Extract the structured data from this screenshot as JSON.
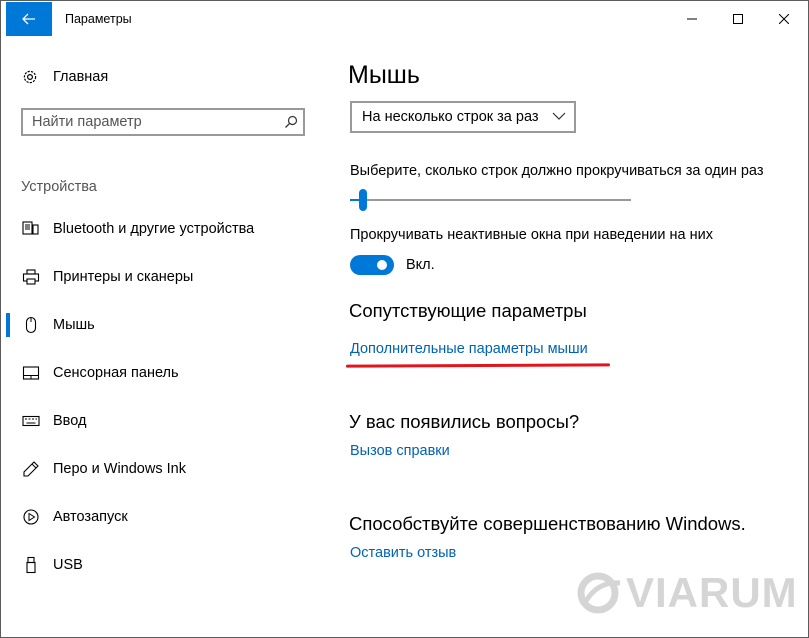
{
  "window": {
    "title": "Параметры",
    "controls": {
      "minimize": "minimize",
      "maximize": "maximize",
      "close": "close"
    }
  },
  "sidebar": {
    "home_label": "Главная",
    "search_placeholder": "Найти параметр",
    "section_title": "Устройства",
    "items": [
      {
        "label": "Bluetooth и другие устройства",
        "icon": "bluetooth-devices-icon",
        "selected": false
      },
      {
        "label": "Принтеры и сканеры",
        "icon": "printer-icon",
        "selected": false
      },
      {
        "label": "Мышь",
        "icon": "mouse-icon",
        "selected": true
      },
      {
        "label": "Сенсорная панель",
        "icon": "touchpad-icon",
        "selected": false
      },
      {
        "label": "Ввод",
        "icon": "keyboard-icon",
        "selected": false
      },
      {
        "label": "Перо и Windows Ink",
        "icon": "pen-icon",
        "selected": false
      },
      {
        "label": "Автозапуск",
        "icon": "autoplay-icon",
        "selected": false
      },
      {
        "label": "USB",
        "icon": "usb-icon",
        "selected": false
      }
    ]
  },
  "main": {
    "title": "Мышь",
    "scroll_mode": "На несколько строк за раз",
    "lines_label": "Выберите, сколько строк должно прокручиваться за один раз",
    "lines_slider_fraction": 0.02,
    "inactive_scroll_label": "Прокручивать неактивные окна при наведении на них",
    "inactive_scroll_state": "Вкл.",
    "related_title": "Сопутствующие параметры",
    "related_link": "Дополнительные параметры мыши",
    "questions_title": "У вас появились вопросы?",
    "help_link": "Вызов справки",
    "improve_title": "Способствуйте совершенствованию Windows.",
    "feedback_link": "Оставить отзыв"
  },
  "watermark": {
    "text": "VIARUM"
  },
  "colors": {
    "accent": "#0078d7",
    "link": "#0063b1",
    "annotation": "#e2151c"
  }
}
